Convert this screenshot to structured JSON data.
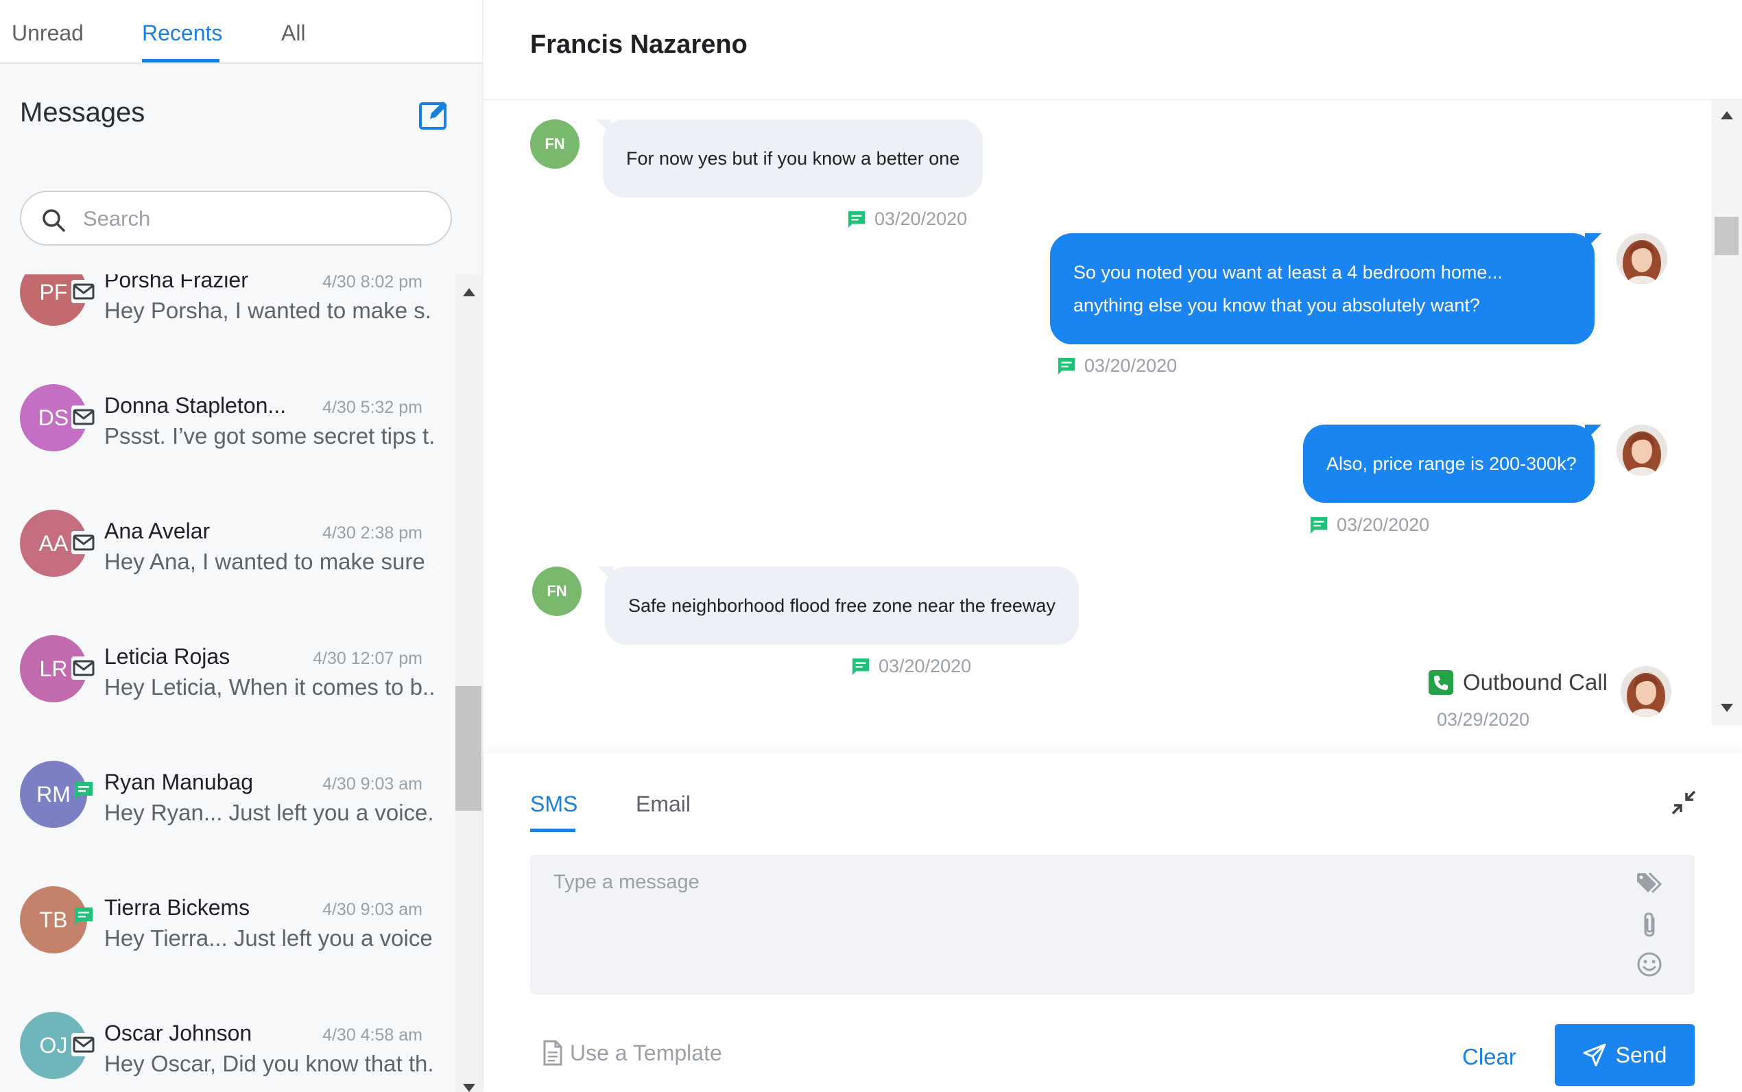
{
  "sidebar": {
    "tabs": [
      {
        "label": "Unread"
      },
      {
        "label": "Recents"
      },
      {
        "label": "All"
      }
    ],
    "title": "Messages",
    "search_placeholder": "Search",
    "conversations": [
      {
        "initials": "PF",
        "name": "Porsha Frazier",
        "time": "4/30 8:02 pm",
        "preview": "Hey Porsha, I wanted to make s...",
        "channel": "email",
        "color": "#c26a6e"
      },
      {
        "initials": "DS",
        "name": "Donna Stapleton...",
        "time": "4/30 5:32 pm",
        "preview": "Pssst. I’ve got some secret tips t...",
        "channel": "email",
        "color": "#c46ec4"
      },
      {
        "initials": "AA",
        "name": "Ana Avelar",
        "time": "4/30 2:38 pm",
        "preview": "Hey Ana, I wanted to make sure ...",
        "channel": "email",
        "color": "#c46d7f"
      },
      {
        "initials": "LR",
        "name": "Leticia Rojas",
        "time": "4/30 12:07 pm",
        "preview": "Hey Leticia, When it comes to b...",
        "channel": "email",
        "color": "#c26aae"
      },
      {
        "initials": "RM",
        "name": "Ryan Manubag",
        "time": "4/30 9:03 am",
        "preview": "Hey Ryan... Just left you a voice...",
        "channel": "sms",
        "color": "#7b80c4"
      },
      {
        "initials": "TB",
        "name": "Tierra Bickems",
        "time": "4/30 9:03 am",
        "preview": "Hey Tierra... Just left you a voice...",
        "channel": "sms",
        "color": "#c4826a"
      },
      {
        "initials": "OJ",
        "name": "Oscar Johnson",
        "time": "4/30 4:58 am",
        "preview": "Hey Oscar, Did you know that th...",
        "channel": "email",
        "color": "#6eb6bb"
      }
    ]
  },
  "chat": {
    "contact_name": "Francis Nazareno",
    "contact_initials": "FN",
    "messages": [
      {
        "direction": "in",
        "lines": [
          "For now yes but if you know a better one"
        ],
        "date": "03/20/2020"
      },
      {
        "direction": "out",
        "lines": [
          "So you noted you want at least a 4 bedroom home...",
          "anything else you know that you absolutely want?"
        ],
        "date": "03/20/2020"
      },
      {
        "direction": "out",
        "lines": [
          "Also, price range is 200-300k?"
        ],
        "date": "03/20/2020"
      },
      {
        "direction": "in",
        "lines": [
          "Safe neighborhood flood free zone near the freeway"
        ],
        "date": "03/20/2020"
      }
    ],
    "call": {
      "label": "Outbound Call",
      "date": "03/29/2020"
    }
  },
  "composer": {
    "tabs": [
      {
        "label": "SMS"
      },
      {
        "label": "Email"
      }
    ],
    "placeholder": "Type a message",
    "template_label": "Use a Template",
    "clear_label": "Clear",
    "send_label": "Send"
  },
  "colors": {
    "accent": "#1a7fe0",
    "out_bubble": "#1a85f0",
    "in_bubble": "#eef0f7",
    "sms_green": "#21c17a",
    "call_green": "#23a247"
  }
}
